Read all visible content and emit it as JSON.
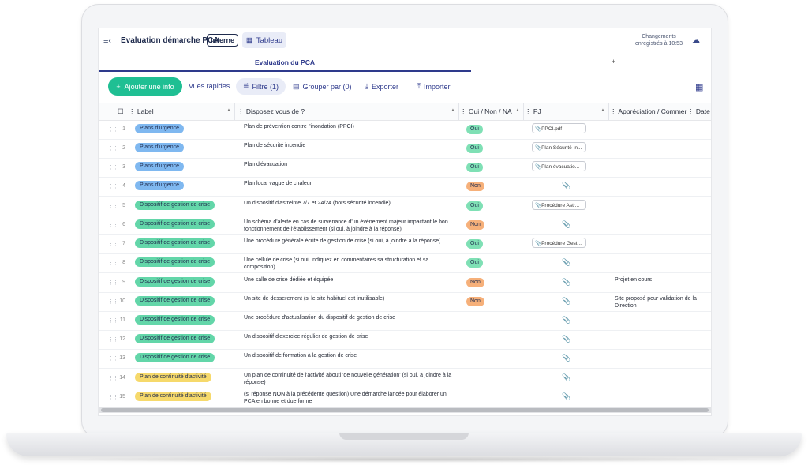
{
  "header": {
    "doc_title": "Evaluation démarche PCA",
    "badge": "Interne",
    "view_tab": "Tableau",
    "save_status_line1": "Changements",
    "save_status_line2": "enregistrés à 10:53"
  },
  "tabs": {
    "active": "Evaluation du PCA",
    "add": "+"
  },
  "toolbar": {
    "add_label": "Ajouter une info",
    "quick_views": "Vues rapides",
    "filter": "Filtre (1)",
    "group_by": "Grouper par (0)",
    "export": "Exporter",
    "import": "Importer"
  },
  "columns": {
    "label": "Label",
    "question": "Disposez vous de ?",
    "answer": "Oui / Non / NA",
    "pj": "PJ",
    "comment": "Appréciation / Commer",
    "date": "Date"
  },
  "colors": {
    "accent": "#2e3a8c",
    "add_button": "#1fbf93",
    "chip_blue": "#7fb8f0",
    "chip_green": "#63d6a9",
    "chip_yellow": "#f6d96b",
    "oui": "#7fe0b5",
    "non": "#f6b07a"
  },
  "rows": [
    {
      "num": "1",
      "label": "Plans d'urgence",
      "label_color": "blue",
      "question": "Plan de prévention contre l'inondation (PPCI)",
      "answer": "Oui",
      "pj": "PPCI.pdf",
      "comment": ""
    },
    {
      "num": "2",
      "label": "Plans d'urgence",
      "label_color": "blue",
      "question": "Plan de sécurité incendie",
      "answer": "Oui",
      "pj": "Plan Sécurité In...",
      "comment": ""
    },
    {
      "num": "3",
      "label": "Plans d'urgence",
      "label_color": "blue",
      "question": "Plan d'évacuation",
      "answer": "Oui",
      "pj": "Plan évacuatio...",
      "comment": ""
    },
    {
      "num": "4",
      "label": "Plans d'urgence",
      "label_color": "blue",
      "question": "Plan local vague de chaleur",
      "answer": "Non",
      "pj": "",
      "comment": ""
    },
    {
      "num": "5",
      "label": "Dispositif de gestion de crise",
      "label_color": "green",
      "question": "Un dispositif d'astreinte 7/7 et 24/24 (hors sécurité incendie)",
      "answer": "Oui",
      "pj": "Procédure Astr...",
      "comment": ""
    },
    {
      "num": "6",
      "label": "Dispositif de gestion de crise",
      "label_color": "green",
      "question": "Un schéma d'alerte en cas de survenance d'un évènement majeur impactant le bon fonctionnement de l'établissement (si oui, à joindre à la réponse)",
      "answer": "Non",
      "pj": "",
      "comment": ""
    },
    {
      "num": "7",
      "label": "Dispositif de gestion de crise",
      "label_color": "green",
      "question": "Une procédure générale écrite de gestion de crise (si oui, à joindre à la réponse)",
      "answer": "Oui",
      "pj": "Procédure Gest...",
      "comment": ""
    },
    {
      "num": "8",
      "label": "Dispositif de gestion de crise",
      "label_color": "green",
      "question": "Une cellule de crise (si oui, indiquez en commentaires sa structuration et sa composition)",
      "answer": "Oui",
      "pj": "",
      "comment": ""
    },
    {
      "num": "9",
      "label": "Dispositif de gestion de crise",
      "label_color": "green",
      "question": "Une salle de crise dédiée et équipée",
      "answer": "Non",
      "pj": "",
      "comment": "Projet en cours"
    },
    {
      "num": "10",
      "label": "Dispositif de gestion de crise",
      "label_color": "green",
      "question": "Un site de desserement (si le site habituel est inutilisable)",
      "answer": "Non",
      "pj": "",
      "comment": "Site proposé pour validation de la Direction"
    },
    {
      "num": "11",
      "label": "Dispositif de gestion de crise",
      "label_color": "green",
      "question": "Une procédure d'actualisation du dispositif de gestion de crise",
      "answer": "",
      "pj": "",
      "comment": ""
    },
    {
      "num": "12",
      "label": "Dispositif de gestion de crise",
      "label_color": "green",
      "question": "Un dispositif d'exercice régulier de gestion de crise",
      "answer": "",
      "pj": "",
      "comment": ""
    },
    {
      "num": "13",
      "label": "Dispositif de gestion de crise",
      "label_color": "green",
      "question": "Un dispositif de formation à la gestion de crise",
      "answer": "",
      "pj": "",
      "comment": ""
    },
    {
      "num": "14",
      "label": "Plan de continuité d'activité",
      "label_color": "yellow",
      "question": "Un plan de continuité de l'activité abouti 'de nouvelle génération' (si oui, à joindre à la réponse)",
      "answer": "",
      "pj": "",
      "comment": ""
    },
    {
      "num": "15",
      "label": "Plan de continuité d'activité",
      "label_color": "yellow",
      "question": "(si réponse NON à la précédente question) Une démarche lancée pour élaborer un PCA en bonne et due forme",
      "answer": "",
      "pj": "",
      "comment": ""
    }
  ]
}
